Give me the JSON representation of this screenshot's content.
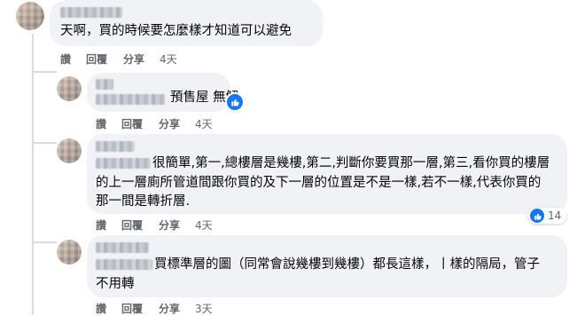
{
  "comments": [
    {
      "text_lines": [
        "天啊，買的時候要怎麼樣才知道可以避免"
      ],
      "actions": {
        "like": "讚",
        "reply": "回覆",
        "share": "分享",
        "time": "4天"
      }
    },
    {
      "text_lines": [
        "預售屋 無解"
      ],
      "actions": {
        "like": "讚",
        "reply": "回覆",
        "share": "分享",
        "time": "4天"
      },
      "reaction": {
        "icon": "thumbs-up-icon",
        "color": "#1877f2"
      }
    },
    {
      "text_lines": [
        "很簡單,第一,總樓層是幾樓,第二,判斷你要買那一層,第三,看你買的樓層",
        "的上一層廁所管道間跟你買的及下一層的位置是不是一樣,若不一樣,代表你買的",
        "那一間是轉折層."
      ],
      "actions": {
        "like": "讚",
        "reply": "回覆",
        "share": "分享",
        "time": "4天"
      },
      "reaction": {
        "icon": "thumbs-up-icon",
        "count": "14",
        "color": "#1877f2"
      }
    },
    {
      "text_lines": [
        "買標準層的圖（同常會說幾樓到幾樓）都長這樣，丨樣的隔局，管子",
        "不用轉"
      ],
      "actions": {
        "like": "讚",
        "reply": "回覆",
        "share": "分享",
        "time": "3天"
      }
    }
  ]
}
